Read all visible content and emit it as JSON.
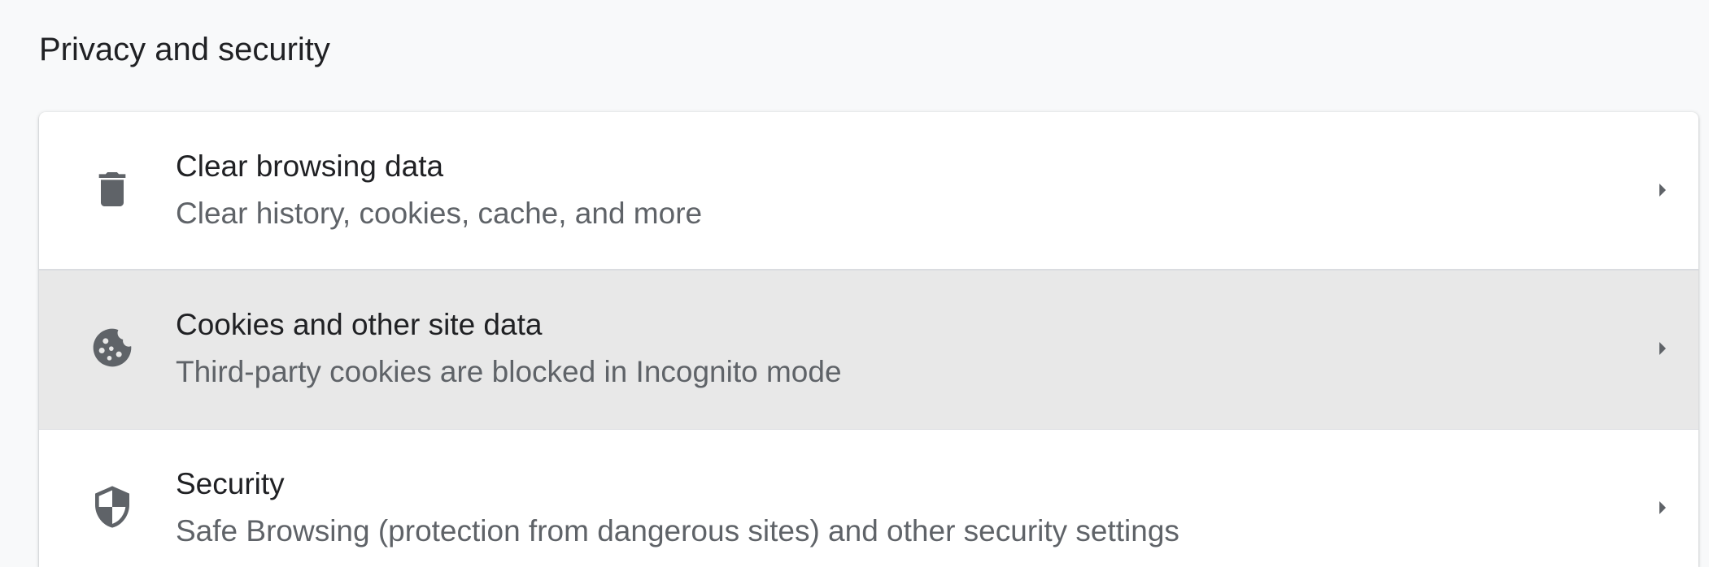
{
  "section": {
    "title": "Privacy and security"
  },
  "rows": [
    {
      "label": "Clear browsing data",
      "sublabel": "Clear history, cookies, cache, and more",
      "icon": "trash-icon"
    },
    {
      "label": "Cookies and other site data",
      "sublabel": "Third-party cookies are blocked in Incognito mode",
      "icon": "cookie-icon"
    },
    {
      "label": "Security",
      "sublabel": "Safe Browsing (protection from dangerous sites) and other security settings",
      "icon": "shield-icon"
    }
  ],
  "colors": {
    "page_background": "#f8f9fa",
    "card_background": "#ffffff",
    "hover_background": "#e8e8e8",
    "primary_text": "#202124",
    "secondary_text": "#5f6368",
    "icon": "#5f6368"
  }
}
